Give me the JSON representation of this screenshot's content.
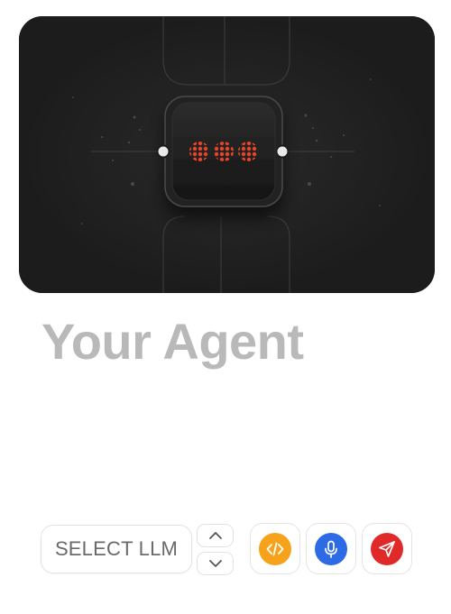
{
  "hero": {
    "illustration": "agent-chip-with-red-dots",
    "accent_color": "#e8442a",
    "background_color": "#1c1c1c"
  },
  "title": "Your Agent",
  "toolbar": {
    "select_llm_label": "SELECT LLM",
    "stepper": {
      "up_icon": "chevron-up-icon",
      "down_icon": "chevron-down-icon"
    },
    "buttons": [
      {
        "name": "code",
        "icon": "code-icon",
        "color": "#f6a21a"
      },
      {
        "name": "microphone",
        "icon": "microphone-icon",
        "color": "#2d6ae6"
      },
      {
        "name": "send",
        "icon": "send-icon",
        "color": "#e02a2a"
      }
    ]
  }
}
